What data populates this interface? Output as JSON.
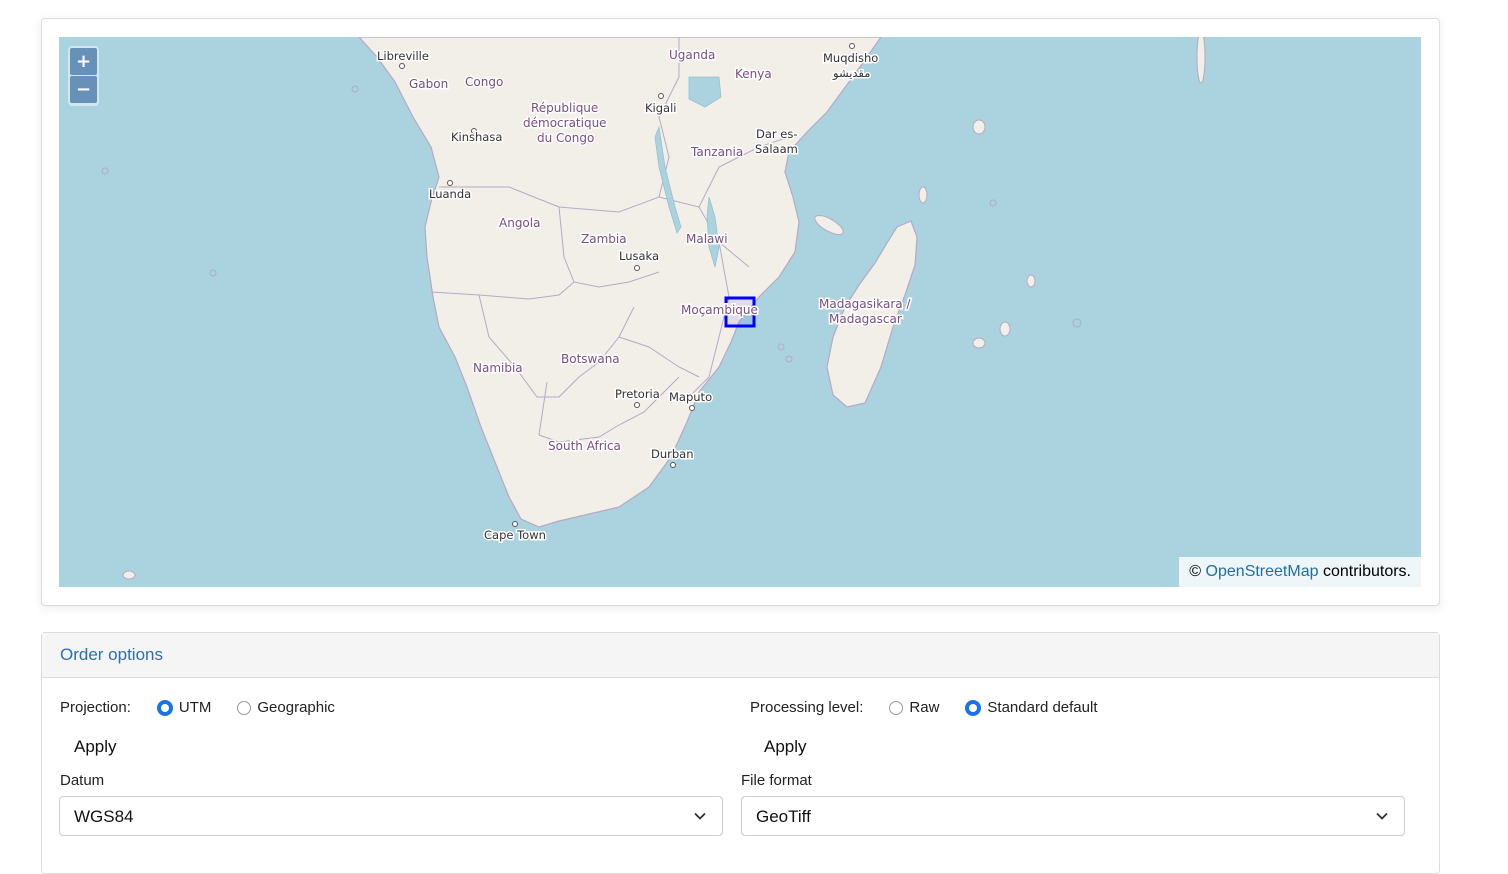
{
  "map": {
    "zoom_in_label": "+",
    "zoom_out_label": "−",
    "attribution": {
      "prefix": "©",
      "link_text": "OpenStreetMap",
      "suffix": "contributors."
    },
    "selection_color": "#0000ff",
    "water_color": "#aad3df",
    "land_color": "#f2efe9",
    "country_labels": [
      "Gabon",
      "Congo",
      "République",
      "démocratique",
      "du Congo",
      "Angola",
      "Zambia",
      "Malawi",
      "Tanzania",
      "Uganda",
      "Kenya",
      "Namibia",
      "Botswana",
      "Moçambique",
      "South Africa",
      "Madagasikara /",
      "Madagascar"
    ],
    "city_labels": [
      "Libreville",
      "Kinshasa",
      "Luanda",
      "Lusaka",
      "Kigali",
      "Dar es-",
      "Salaam",
      "Muqdisho",
      "مقديشو",
      "Pretoria",
      "Maputo",
      "Durban",
      "Cape Town"
    ]
  },
  "order": {
    "title": "Order options",
    "projection": {
      "label": "Projection:",
      "options": [
        "UTM",
        "Geographic"
      ],
      "selected": "UTM",
      "apply_label": "Apply"
    },
    "processing": {
      "label": "Processing level:",
      "options": [
        "Raw",
        "Standard default"
      ],
      "selected": "Standard default",
      "apply_label": "Apply"
    },
    "datum": {
      "label": "Datum",
      "value": "WGS84"
    },
    "file_format": {
      "label": "File format",
      "value": "GeoTiff"
    }
  }
}
